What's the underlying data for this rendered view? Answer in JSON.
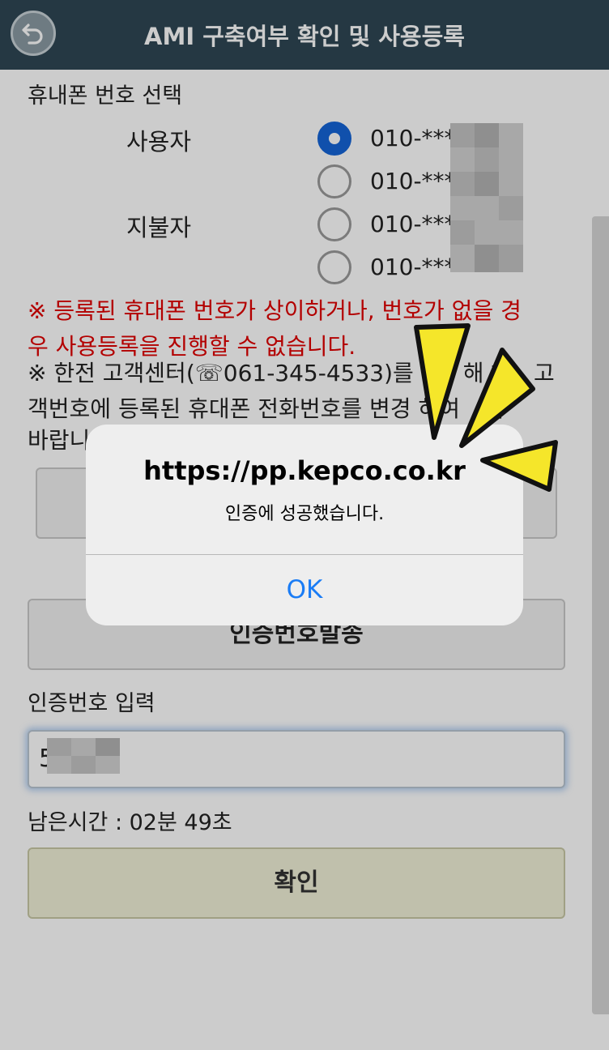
{
  "header": {
    "title": "AMI 구축여부 확인 및 사용등록",
    "back_icon": "back-arrow-icon"
  },
  "phone_select": {
    "label": "휴내폰 번호 선택",
    "user_label": "사용자",
    "payer_label": "지불자",
    "options": [
      {
        "number": "010-***",
        "selected": true
      },
      {
        "number": "010-***",
        "selected": false
      },
      {
        "number": "010-***",
        "selected": false
      },
      {
        "number": "010-***",
        "selected": false
      }
    ]
  },
  "notices": {
    "warning_line1": "※ 등록된 휴대폰 번호가 상이하거나, 번호가 없을 경",
    "warning_line2": "우 사용등록을 진행할 수 없습니다.",
    "info_line1": "※ 한전 고객센터(☏061-345-4533)를",
    "info_line1_tail": "해 하",
    "info_line1_end": "고",
    "info_line2": "객번호에 등록된 휴대폰 전화번호를 변경",
    "info_line2_tail": "하여",
    "info_line2_end": "기",
    "info_line3": "바랍니"
  },
  "send_code_button": "인증번호발송",
  "code_input": {
    "label": "인증번호 입력",
    "value": "5"
  },
  "timer": "남은시간 : 02분 49초",
  "confirm_button": "확인",
  "dialog": {
    "title": "https://pp.kepco.co.kr",
    "message": "인증에 성공했습니다.",
    "ok_label": "OK"
  },
  "colors": {
    "header_bg": "#2f4754",
    "warning_red": "#e00000",
    "radio_selected": "#1565d8",
    "ok_blue": "#1a7cf5",
    "confirm_bg": "#f0f0d8",
    "sparkle_yellow": "#f5e62a"
  }
}
